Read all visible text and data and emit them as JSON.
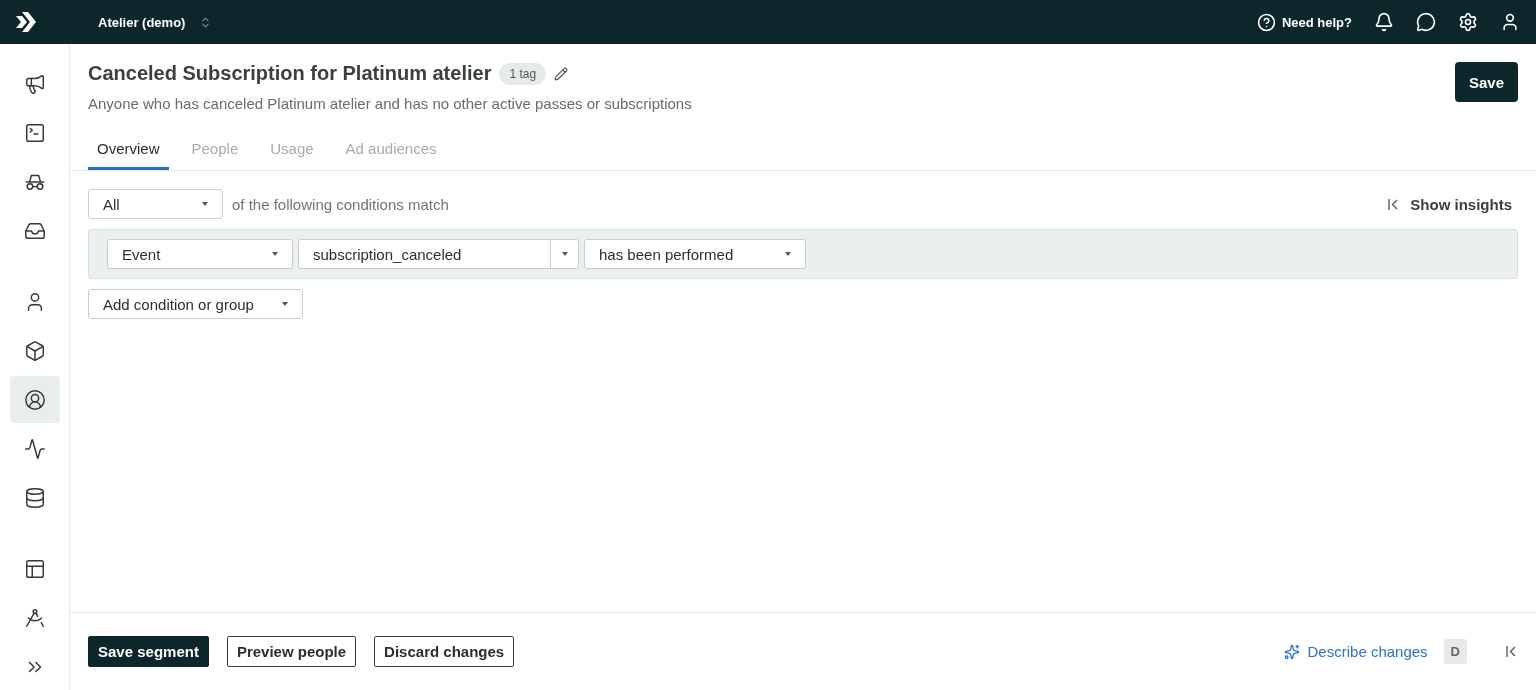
{
  "topbar": {
    "workspace": "Atelier (demo)",
    "help": "Need help?"
  },
  "sidebar": {
    "items": [
      {
        "selected": false
      },
      {
        "selected": false
      },
      {
        "selected": false
      },
      {
        "selected": false
      },
      {
        "selected": false
      },
      {
        "selected": false
      },
      {
        "selected": true
      },
      {
        "selected": false
      },
      {
        "selected": false
      },
      {
        "selected": false
      },
      {
        "selected": false
      },
      {
        "selected": false
      }
    ]
  },
  "header": {
    "title": "Canceled Subscription for Platinum atelier",
    "tag": "1 tag",
    "description": "Anyone who has canceled Platinum atelier and has no other active passes or subscriptions",
    "save": "Save"
  },
  "tabs": [
    {
      "label": "Overview",
      "selected": true
    },
    {
      "label": "People",
      "selected": false
    },
    {
      "label": "Usage",
      "selected": false
    },
    {
      "label": "Ad audiences",
      "selected": false
    }
  ],
  "match": {
    "value": "All",
    "text": "of the following conditions match",
    "insights": "Show insights"
  },
  "condition": {
    "type": "Event",
    "event": "subscription_canceled",
    "operator": "has been performed"
  },
  "add_button": "Add condition or group",
  "footer": {
    "buttons": [
      {
        "label": "Save segment",
        "kind": "primary"
      },
      {
        "label": "Preview people",
        "kind": "outline"
      },
      {
        "label": "Discard changes",
        "kind": "outline"
      }
    ],
    "describe": "Describe changes",
    "shortcut": "D"
  }
}
